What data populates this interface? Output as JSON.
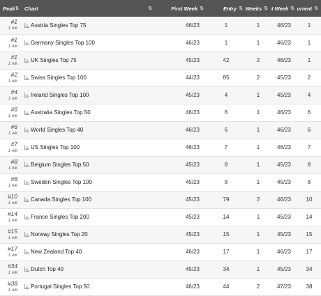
{
  "headers": {
    "peak": "Peak",
    "chart": "Chart",
    "first_week": "First Week",
    "entry": "Entry",
    "weeks": "Weeks",
    "last_week": "Last Week",
    "current": "Current"
  },
  "rows": [
    {
      "peak": "#1",
      "peak_weeks": "1 wk",
      "chart": "Austria Singles Top 75",
      "first_week": "46/23",
      "entry": "1",
      "weeks": "1",
      "last_week": "46/23",
      "current": "1"
    },
    {
      "peak": "#1",
      "peak_weeks": "1 wk",
      "chart": "Germany Singles Top 100",
      "first_week": "46/23",
      "entry": "1",
      "weeks": "1",
      "last_week": "46/23",
      "current": "1"
    },
    {
      "peak": "#1",
      "peak_weeks": "1 wk",
      "chart": "UK Singles Top 75",
      "first_week": "45/23",
      "entry": "42",
      "weeks": "2",
      "last_week": "46/23",
      "current": "1"
    },
    {
      "peak": "#2",
      "peak_weeks": "1 wk",
      "chart": "Swiss Singles Top 100",
      "first_week": "44/23",
      "entry": "85",
      "weeks": "2",
      "last_week": "45/23",
      "current": "2"
    },
    {
      "peak": "#4",
      "peak_weeks": "1 wk",
      "chart": "Ireland Singles Top 100",
      "first_week": "45/23",
      "entry": "4",
      "weeks": "1",
      "last_week": "45/23",
      "current": "4"
    },
    {
      "peak": "#6",
      "peak_weeks": "1 wk",
      "chart": "Australia Singles Top 50",
      "first_week": "46/23",
      "entry": "6",
      "weeks": "1",
      "last_week": "46/23",
      "current": "6"
    },
    {
      "peak": "#6",
      "peak_weeks": "1 wk",
      "chart": "World Singles Top 40",
      "first_week": "46/23",
      "entry": "6",
      "weeks": "1",
      "last_week": "46/23",
      "current": "6"
    },
    {
      "peak": "#7",
      "peak_weeks": "1 wk",
      "chart": "US Singles Top 100",
      "first_week": "46/23",
      "entry": "7",
      "weeks": "1",
      "last_week": "46/23",
      "current": "7"
    },
    {
      "peak": "#8",
      "peak_weeks": "1 wk",
      "chart": "Belgium Singles Top 50",
      "first_week": "45/23",
      "entry": "8",
      "weeks": "1",
      "last_week": "45/23",
      "current": "8"
    },
    {
      "peak": "#8",
      "peak_weeks": "1 wk",
      "chart": "Sweden Singles Top 100",
      "first_week": "45/23",
      "entry": "8",
      "weeks": "1",
      "last_week": "45/23",
      "current": "8"
    },
    {
      "peak": "#10",
      "peak_weeks": "1 wk",
      "chart": "Canada Singles Top 100",
      "first_week": "45/23",
      "entry": "79",
      "weeks": "2",
      "last_week": "46/23",
      "current": "10"
    },
    {
      "peak": "#14",
      "peak_weeks": "1 wk",
      "chart": "France Singles Top 200",
      "first_week": "45/23",
      "entry": "14",
      "weeks": "1",
      "last_week": "45/23",
      "current": "14"
    },
    {
      "peak": "#15",
      "peak_weeks": "1 wk",
      "chart": "Norway Singles Top 20",
      "first_week": "45/23",
      "entry": "15",
      "weeks": "1",
      "last_week": "45/23",
      "current": "15"
    },
    {
      "peak": "#17",
      "peak_weeks": "1 wk",
      "chart": "New Zealand Top 40",
      "first_week": "46/23",
      "entry": "17",
      "weeks": "1",
      "last_week": "46/23",
      "current": "17"
    },
    {
      "peak": "#34",
      "peak_weeks": "1 wk",
      "chart": "Dutch Top 40",
      "first_week": "45/23",
      "entry": "34",
      "weeks": "1",
      "last_week": "45/23",
      "current": "34"
    },
    {
      "peak": "#38",
      "peak_weeks": "1 wk",
      "chart": "Portugal Singles Top 50",
      "first_week": "46/23",
      "entry": "44",
      "weeks": "2",
      "last_week": "47/23",
      "current": "38"
    }
  ],
  "icons": {
    "chart_row": "bar-chart-icon",
    "sort": "sort-arrows-icon"
  },
  "colors": {
    "header_bg": "#555555",
    "row_alt_bg": "#f6f6f6",
    "row_bg": "#ffffff",
    "chart_icon": "#999999"
  }
}
